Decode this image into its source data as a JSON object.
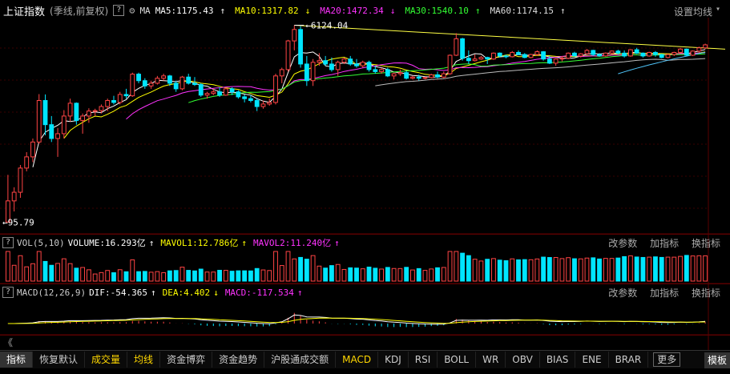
{
  "header": {
    "title": "上证指数",
    "subtitle": "(季线,前复权)",
    "help": "?",
    "ma_label": "MA",
    "ma": [
      {
        "label": "MA5:1175.43",
        "arrow": "↑",
        "color": "#ffffff"
      },
      {
        "label": "MA10:1317.82",
        "arrow": "↓",
        "color": "#ffff00"
      },
      {
        "label": "MA20:1472.34",
        "arrow": "↓",
        "color": "#ff33ff"
      },
      {
        "label": "MA30:1540.10",
        "arrow": "↑",
        "color": "#33ff33"
      },
      {
        "label": "MA60:1174.15",
        "arrow": "↑",
        "color": "#dddddd"
      }
    ],
    "settings": "设置均线",
    "caret": "▾"
  },
  "volume_panel": {
    "name": "VOL(5,10)",
    "items": [
      {
        "label": "VOLUME:16.293亿",
        "arrow": "↑",
        "color": "#ffffff"
      },
      {
        "label": "MAVOL1:12.786亿",
        "arrow": "↑",
        "color": "#ffff00"
      },
      {
        "label": "MAVOL2:11.240亿",
        "arrow": "↑",
        "color": "#ff33ff"
      }
    ],
    "tools": [
      "改参数",
      "加指标",
      "换指标"
    ],
    "help": "?"
  },
  "macd_panel": {
    "name": "MACD(12,26,9)",
    "items": [
      {
        "label": "DIF:-54.365",
        "arrow": "↑",
        "color": "#ffffff"
      },
      {
        "label": "DEA:4.402",
        "arrow": "↓",
        "color": "#ffff00"
      },
      {
        "label": "MACD:-117.534",
        "arrow": "↑",
        "color": "#ff33ff"
      }
    ],
    "tools": [
      "改参数",
      "加指标",
      "换指标"
    ],
    "help": "?"
  },
  "scroll_arrow": "《",
  "tabs": [
    "指标",
    "恢复默认",
    "成交量",
    "均线",
    "资金博弈",
    "资金趋势",
    "沪股通成交额",
    "MACD",
    "KDJ",
    "RSI",
    "BOLL",
    "WR",
    "OBV",
    "BIAS",
    "ENE",
    "BRAR"
  ],
  "tabs_active": "指标",
  "tabs_highlight": [
    "成交量",
    "均线",
    "MACD"
  ],
  "more_label": "更多",
  "template_label": "模板",
  "colors": {
    "up": "#ff4444",
    "down": "#00e5ff",
    "trend": "#ffff44",
    "ma60": "#4fc3f7"
  },
  "chart_data": {
    "type": "candlestick",
    "annotations": [
      {
        "label": "6124.04",
        "kind": "high",
        "value": 6124.04
      },
      {
        "label": "95.79",
        "kind": "low",
        "value": 95.79
      }
    ],
    "ylim": [
      80,
      6500
    ],
    "candles": [
      [
        96,
        260,
        95.8,
        150
      ],
      [
        150,
        200,
        120,
        180
      ],
      [
        180,
        320,
        160,
        300
      ],
      [
        300,
        420,
        280,
        380
      ],
      [
        380,
        560,
        340,
        520
      ],
      [
        520,
        1430,
        500,
        1250
      ],
      [
        1250,
        1420,
        600,
        750
      ],
      [
        750,
        900,
        520,
        560
      ],
      [
        560,
        700,
        380,
        620
      ],
      [
        620,
        1020,
        560,
        900
      ],
      [
        900,
        1300,
        800,
        1180
      ],
      [
        1180,
        1200,
        750,
        820
      ],
      [
        820,
        950,
        620,
        900
      ],
      [
        900,
        1060,
        780,
        1000
      ],
      [
        1000,
        1050,
        900,
        1010
      ],
      [
        1010,
        1150,
        950,
        1100
      ],
      [
        1100,
        1300,
        1000,
        1250
      ],
      [
        1250,
        1380,
        1150,
        1200
      ],
      [
        1200,
        1500,
        1150,
        1420
      ],
      [
        1420,
        1600,
        1300,
        1380
      ],
      [
        1380,
        2250,
        1350,
        2180
      ],
      [
        2180,
        2250,
        1800,
        1900
      ],
      [
        1900,
        2000,
        1600,
        1700
      ],
      [
        1700,
        1900,
        1600,
        1800
      ],
      [
        1800,
        2100,
        1750,
        2000
      ],
      [
        2000,
        2200,
        1900,
        2100
      ],
      [
        2100,
        2150,
        1700,
        1800
      ],
      [
        1800,
        1900,
        1500,
        1600
      ],
      [
        1600,
        2100,
        1550,
        2050
      ],
      [
        2050,
        2200,
        1750,
        1800
      ],
      [
        1800,
        2050,
        1700,
        1750
      ],
      [
        1750,
        1800,
        1350,
        1400
      ],
      [
        1400,
        1500,
        1300,
        1450
      ],
      [
        1450,
        1600,
        1400,
        1500
      ],
      [
        1500,
        1650,
        1350,
        1400
      ],
      [
        1400,
        1650,
        1380,
        1600
      ],
      [
        1600,
        1650,
        1400,
        1500
      ],
      [
        1500,
        1550,
        1300,
        1350
      ],
      [
        1350,
        1420,
        1200,
        1300
      ],
      [
        1300,
        1400,
        1200,
        1250
      ],
      [
        1250,
        1300,
        1000,
        1100
      ],
      [
        1100,
        1250,
        1050,
        1160
      ],
      [
        1160,
        1300,
        1120,
        1200
      ],
      [
        1200,
        2200,
        1150,
        2100
      ],
      [
        2100,
        2500,
        1800,
        2400
      ],
      [
        2400,
        4500,
        2300,
        4400
      ],
      [
        4400,
        6124,
        3600,
        5600
      ],
      [
        5600,
        6000,
        2500,
        2700
      ],
      [
        2700,
        3200,
        1700,
        1900
      ],
      [
        1900,
        3000,
        1700,
        2800
      ],
      [
        2800,
        3400,
        2600,
        2900
      ],
      [
        2900,
        3200,
        2600,
        2700
      ],
      [
        2700,
        3100,
        2300,
        2400
      ],
      [
        2400,
        2900,
        2100,
        2800
      ],
      [
        2800,
        3100,
        2700,
        3000
      ],
      [
        3000,
        3200,
        2600,
        2700
      ],
      [
        2700,
        3000,
        2500,
        2600
      ],
      [
        2600,
        2900,
        2500,
        2800
      ],
      [
        2800,
        2900,
        2300,
        2400
      ],
      [
        2400,
        2600,
        2200,
        2300
      ],
      [
        2300,
        2500,
        2200,
        2400
      ],
      [
        2400,
        2500,
        2050,
        2100
      ],
      [
        2100,
        2250,
        1950,
        2200
      ],
      [
        2200,
        2400,
        2100,
        2250
      ],
      [
        2250,
        2350,
        1950,
        2000
      ],
      [
        2000,
        2100,
        1950,
        2050
      ],
      [
        2050,
        2150,
        1900,
        2000
      ],
      [
        2000,
        2050,
        1950,
        2030
      ],
      [
        2030,
        2200,
        2000,
        2150
      ],
      [
        2150,
        2300,
        2000,
        2050
      ],
      [
        2050,
        2300,
        2000,
        2200
      ],
      [
        2200,
        3300,
        2150,
        3250
      ],
      [
        3250,
        5180,
        3200,
        4600
      ],
      [
        4600,
        4700,
        2900,
        3050
      ],
      [
        3050,
        3600,
        2700,
        2900
      ],
      [
        2900,
        3300,
        2850,
        3000
      ],
      [
        3000,
        3200,
        2950,
        3100
      ],
      [
        3100,
        3150,
        2700,
        3000
      ],
      [
        3000,
        3450,
        2950,
        3400
      ],
      [
        3400,
        3450,
        3100,
        3200
      ],
      [
        3200,
        3300,
        3050,
        3150
      ],
      [
        3150,
        3550,
        3100,
        3450
      ],
      [
        3450,
        3600,
        3250,
        3300
      ],
      [
        3300,
        3400,
        3050,
        3100
      ],
      [
        3100,
        3350,
        3050,
        3300
      ],
      [
        3300,
        3600,
        3200,
        3500
      ],
      [
        3500,
        3550,
        2900,
        3000
      ],
      [
        3000,
        3200,
        2700,
        2750
      ],
      [
        2750,
        3050,
        2600,
        3000
      ],
      [
        3000,
        3200,
        2850,
        3050
      ],
      [
        3050,
        3450,
        3000,
        3400
      ],
      [
        3400,
        3500,
        3150,
        3200
      ],
      [
        3200,
        3400,
        3100,
        3350
      ],
      [
        3350,
        3700,
        3300,
        3600
      ],
      [
        3600,
        3650,
        3200,
        3300
      ],
      [
        3300,
        3400,
        3150,
        3200
      ],
      [
        3200,
        3450,
        3150,
        3400
      ],
      [
        3400,
        3600,
        3300,
        3550
      ],
      [
        3550,
        3650,
        3300,
        3400
      ],
      [
        3400,
        3600,
        3100,
        3200
      ],
      [
        3200,
        3700,
        3150,
        3650
      ],
      [
        3650,
        3800,
        3350,
        3400
      ],
      [
        3400,
        3450,
        3100,
        3200
      ],
      [
        3200,
        3500,
        3150,
        3450
      ],
      [
        3450,
        3550,
        3150,
        3300
      ],
      [
        3300,
        3350,
        3050,
        3100
      ],
      [
        3100,
        3350,
        3050,
        3300
      ],
      [
        3300,
        3500,
        3200,
        3450
      ],
      [
        3450,
        3800,
        3400,
        3700
      ],
      [
        3700,
        3750,
        3200,
        3250
      ],
      [
        3250,
        3600,
        3200,
        3550
      ],
      [
        3550,
        3900,
        3450,
        3800
      ],
      [
        3800,
        4150,
        3700,
        4050
      ]
    ]
  }
}
